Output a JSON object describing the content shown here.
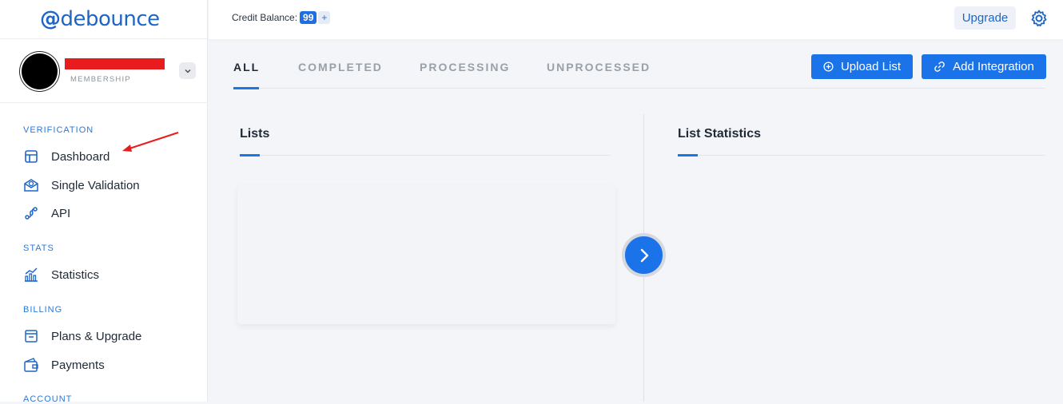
{
  "app": {
    "logo_at": "@",
    "logo_text": "debounce"
  },
  "profile": {
    "membership": "MEMBERSHIP"
  },
  "sidebar": {
    "sections": [
      {
        "label": "VERIFICATION"
      },
      {
        "label": "STATS"
      },
      {
        "label": "BILLING"
      },
      {
        "label": "ACCOUNT"
      }
    ],
    "items": [
      {
        "label": "Dashboard",
        "icon": "dashboard-icon"
      },
      {
        "label": "Single Validation",
        "icon": "envelope-check-icon"
      },
      {
        "label": "API",
        "icon": "api-icon"
      },
      {
        "label": "Statistics",
        "icon": "chart-icon"
      },
      {
        "label": "Plans & Upgrade",
        "icon": "plans-icon"
      },
      {
        "label": "Payments",
        "icon": "wallet-icon"
      }
    ]
  },
  "topbar": {
    "credit_label": "Credit Balance:",
    "credit_value": "99",
    "credit_plus": "+",
    "upgrade_label": "Upgrade"
  },
  "tabs": [
    {
      "label": "ALL",
      "active": true
    },
    {
      "label": "COMPLETED",
      "active": false
    },
    {
      "label": "PROCESSING",
      "active": false
    },
    {
      "label": "UNPROCESSED",
      "active": false
    }
  ],
  "actions": {
    "upload_label": "Upload List",
    "integration_label": "Add Integration"
  },
  "panels": {
    "lists_title": "Lists",
    "stats_title": "List Statistics"
  },
  "colors": {
    "accent": "#1a73e8",
    "annotation_arrow": "#e81c1c",
    "redaction": "#e81c1c"
  }
}
